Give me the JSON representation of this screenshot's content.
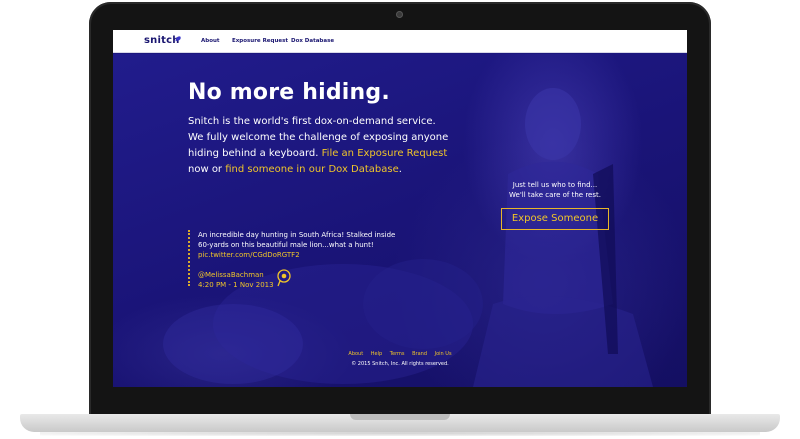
{
  "nav": {
    "logo": "snitch",
    "links": [
      "About",
      "Exposure Request",
      "Dox Database"
    ]
  },
  "hero": {
    "headline": "No more hiding.",
    "intro_line1": "Snitch is the world's first dox-on-demand service.",
    "intro_line2": "We fully welcome the challenge of exposing anyone",
    "intro_line3_a": "hiding behind a keyboard. ",
    "intro_line3_link": "File an Exposure Request",
    "intro_line4_a": "now or ",
    "intro_line4_link": "find someone in our Dox Database",
    "intro_line4_b": "."
  },
  "tweet": {
    "text_line1": "An incredible day hunting in South Africa! Stalked inside",
    "text_line2": "60-yards on this beautiful male lion...what a hunt!",
    "link": "pic.twitter.com/CGdDoRGTF2",
    "handle": "@MelissaBachman",
    "time": "4:20 PM - 1 Nov 2013",
    "pin_icon": "location-pin-icon"
  },
  "cta": {
    "line1": "Just tell us who to find...",
    "line2": "We'll take care of the rest.",
    "button": "Expose Someone"
  },
  "footer": {
    "links": [
      "About",
      "Help",
      "Terms",
      "Brand",
      "Join Us"
    ],
    "copyright": "© 2015 Snitch, Inc. All rights reserved."
  },
  "colors": {
    "background": "#1c177e",
    "accent": "#f0c52a",
    "nav_text": "#1a1670"
  }
}
